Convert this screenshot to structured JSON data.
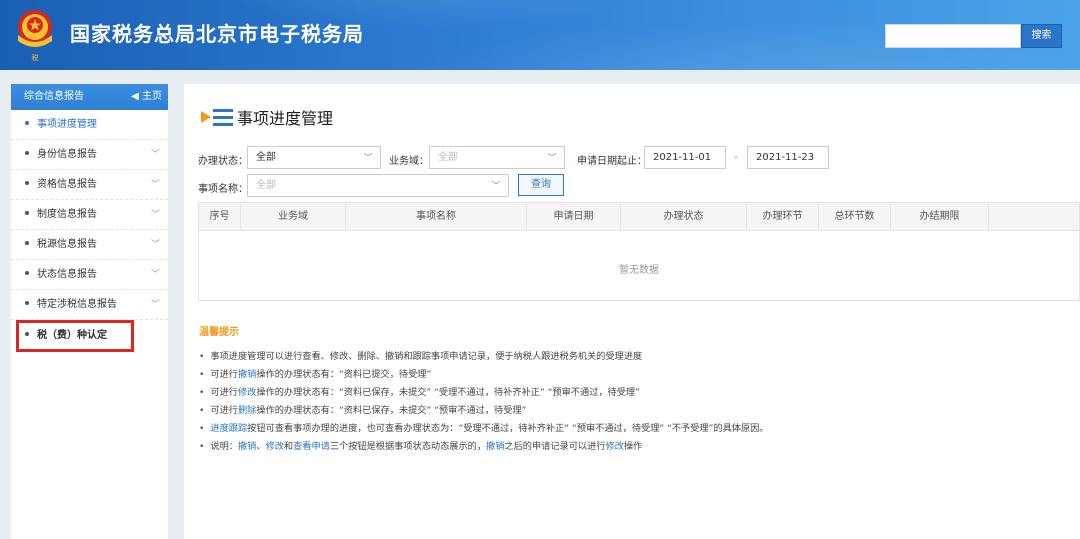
{
  "header": {
    "site_title": "国家税务总局北京市电子税务局",
    "search_placeholder": "",
    "search_button": "搜索"
  },
  "sidebar": {
    "title": "综合信息报告",
    "home_label": "主页",
    "items": [
      {
        "label": "事项进度管理",
        "active": true,
        "expandable": false
      },
      {
        "label": "身份信息报告",
        "active": false,
        "expandable": true
      },
      {
        "label": "资格信息报告",
        "active": false,
        "expandable": true
      },
      {
        "label": "制度信息报告",
        "active": false,
        "expandable": true
      },
      {
        "label": "税源信息报告",
        "active": false,
        "expandable": true
      },
      {
        "label": "状态信息报告",
        "active": false,
        "expandable": true
      },
      {
        "label": "特定涉税信息报告",
        "active": false,
        "expandable": true
      },
      {
        "label": "税（费）种认定",
        "active": false,
        "expandable": false,
        "highlighted": true
      }
    ]
  },
  "main": {
    "page_title": "事项进度管理",
    "filters": {
      "status_label": "办理状态：",
      "status_value": "全部",
      "domain_label": "业务域：",
      "domain_value": "全部",
      "date_label": "申请日期起止：",
      "date_start": "2021-11-01",
      "date_sep": "-",
      "date_end": "2021-11-23",
      "item_label": "事项名称：",
      "item_value": "全部",
      "query_button": "查询"
    },
    "table": {
      "columns": [
        "序号",
        "业务域",
        "事项名称",
        "申请日期",
        "办理状态",
        "办理环节",
        "总环节数",
        "办结期限"
      ],
      "empty_text": "暂无数据"
    },
    "tips": {
      "title": "温馨提示",
      "lines": [
        {
          "pre": "事项进度管理可以进行查看、修改、删除、撤销和跟踪事项申请记录，便于纳税人跟进税务机关的受理进度",
          "hl": "",
          "post": ""
        },
        {
          "pre": "可进行",
          "hl": "撤销",
          "post": "操作的办理状态有：“资料已提交，待受理”"
        },
        {
          "pre": "可进行",
          "hl": "修改",
          "post": "操作的办理状态有：“资料已保存，未提交” “受理不通过，待补齐补正” “预审不通过，待受理”"
        },
        {
          "pre": "可进行",
          "hl": "删除",
          "post": "操作的办理状态有：“资料已保存，未提交” “预审不通过，待受理”"
        },
        {
          "pre": "",
          "hl": "进度跟踪",
          "post": "按钮可查看事项办理的进度，也可查看办理状态为：“受理不通过，待补齐补正” “预审不通过，待受理” “不予受理”的具体原因。"
        }
      ],
      "last_line": {
        "p1": "说明：",
        "h1": "撤销",
        "p2": "、",
        "h2": "修改",
        "p3": "和",
        "h3": "查看申请",
        "p4": "三个按钮是根据事项状态动态展示的，",
        "h4": "撤销",
        "p5": "之后的申请记录可以进行",
        "h5": "修改",
        "p6": "操作"
      }
    }
  },
  "colors": {
    "header_blue": "#2f7fd6",
    "accent_blue": "#2a74c9",
    "tips_orange": "#f39a1e",
    "highlight_red": "#e0241f"
  }
}
